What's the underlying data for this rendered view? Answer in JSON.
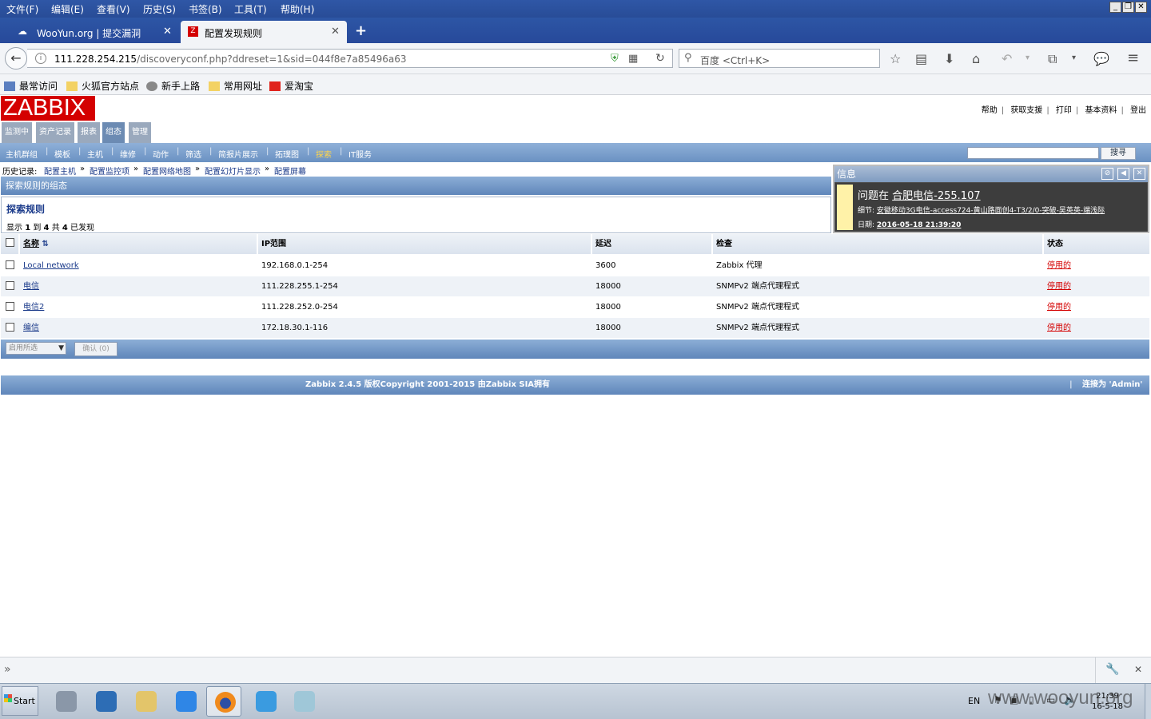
{
  "menubar": {
    "items": [
      "文件(F)",
      "编辑(E)",
      "查看(V)",
      "历史(S)",
      "书签(B)",
      "工具(T)",
      "帮助(H)"
    ]
  },
  "tabs": [
    {
      "label": "WooYun.org | 提交漏洞"
    },
    {
      "label": "配置发现规则"
    }
  ],
  "address": {
    "host": "111.228.254.215",
    "path": "/discoveryconf.php?ddreset=1&sid=044f8e7a85496a63"
  },
  "search": {
    "placeholder": "百度 <Ctrl+K>"
  },
  "bookmarks": [
    "最常访问",
    "火狐官方站点",
    "新手上路",
    "常用网址",
    "爱淘宝"
  ],
  "zabbix": {
    "logo": "ZABBIX",
    "toplinks": [
      "帮助",
      "获取支援",
      "打印",
      "基本资料",
      "登出"
    ],
    "main_menu": [
      "监测中",
      "资产记录",
      "报表",
      "组态",
      "管理"
    ],
    "sub_menu": [
      "主机群组",
      "模板",
      "主机",
      "维修",
      "动作",
      "筛选",
      "简报片展示",
      "拓璞图",
      "探索",
      "IT服务"
    ],
    "search_button": "搜寻",
    "history_label": "历史记录:",
    "history": [
      "配置主机",
      "配置监控项",
      "配置网络地图",
      "配置幻灯片显示",
      "配置屏幕"
    ],
    "section_header": "探索规则的组态",
    "page_title": "探索规则",
    "count": {
      "prefix": "显示",
      "from": "1",
      "to_word": "到",
      "to": "4",
      "of_word": "共",
      "total": "4",
      "suffix": "已发现"
    },
    "columns": [
      "名称",
      "IP范围",
      "延迟",
      "检查",
      "状态"
    ],
    "rows": [
      {
        "name": "Local network",
        "ip": "192.168.0.1-254",
        "delay": "3600",
        "check": "Zabbix 代理",
        "status": "停用的"
      },
      {
        "name": "电信",
        "ip": "111.228.255.1-254",
        "delay": "18000",
        "check": "SNMPv2 端点代理程式",
        "status": "停用的"
      },
      {
        "name": "电信2",
        "ip": "111.228.252.0-254",
        "delay": "18000",
        "check": "SNMPv2 端点代理程式",
        "status": "停用的"
      },
      {
        "name": "编信",
        "ip": "172.18.30.1-116",
        "delay": "18000",
        "check": "SNMPv2 端点代理程式",
        "status": "停用的"
      }
    ],
    "action_select": "启用所选",
    "confirm_button": "确认 (0)",
    "copyright": "Zabbix 2.4.5 版权Copyright 2001-2015 由Zabbix SIA拥有",
    "connected": "连接为 'Admin'"
  },
  "popup": {
    "title": "信息",
    "problem_prefix": "问题在",
    "problem_host": "合肥电信-255.107",
    "detail_label": "细节:",
    "detail": "安徽移动3G电信-access724-黄山路面创4-T3/2/0-突破-吴英英-端浅际",
    "date_label": "日期:",
    "date": "2016-05-18 21:39:20"
  },
  "taskbar": {
    "start": "Start",
    "lang": "EN",
    "time": "21:39",
    "date": "16-5-18",
    "watermark": "www.wooyun.org"
  },
  "colors": {
    "zabbix_red": "#d40000",
    "header_blue": "#6a91c2",
    "link": "#1a3a8a"
  }
}
